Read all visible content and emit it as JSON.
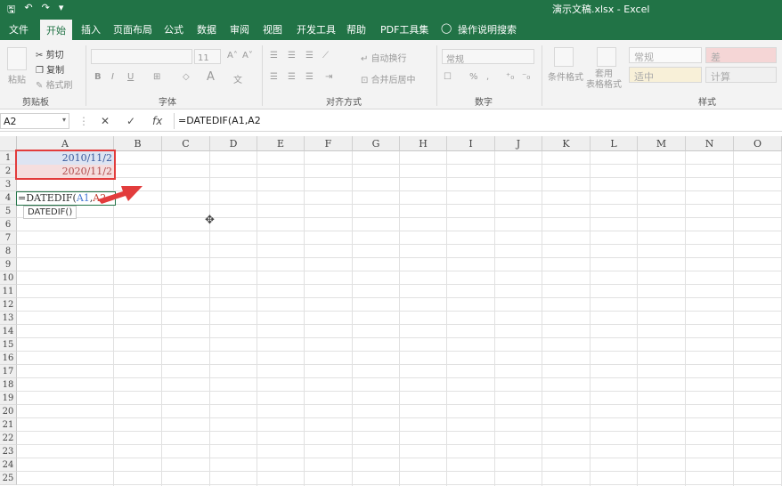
{
  "titlebar": {
    "save": "🖫",
    "undo": "↶",
    "redo": "↷",
    "more": "▾",
    "title": "演示文稿.xlsx  -  Excel"
  },
  "menu": [
    "文件",
    "开始",
    "插入",
    "页面布局",
    "公式",
    "数据",
    "审阅",
    "视图",
    "开发工具",
    "帮助",
    "PDF工具集",
    "操作说明搜索"
  ],
  "ribbon": {
    "clipboard": {
      "paste": "粘贴",
      "cut": "剪切",
      "copy": "复制",
      "format_painter": "格式刷",
      "label": "剪贴板"
    },
    "font": {
      "size": "11",
      "label": "字体"
    },
    "alignment": {
      "wrap": "自动换行",
      "merge": "合并后居中",
      "label": "对齐方式"
    },
    "number": {
      "format": "常规",
      "label": "数字"
    },
    "styles": {
      "cond": "条件格式",
      "table": "套用\n表格格式",
      "normal": "常规",
      "bad": "差",
      "neutral": "适中",
      "calc": "计算",
      "label": "样式"
    }
  },
  "formula_bar": {
    "name_box": "A2",
    "cancel": "✕",
    "enter": "✓",
    "fx": "fx",
    "formula": "=DATEDIF(A1,A2"
  },
  "columns": [
    "A",
    "B",
    "C",
    "D",
    "E",
    "F",
    "G",
    "H",
    "I",
    "J",
    "K",
    "L",
    "M",
    "N",
    "O"
  ],
  "rows": [
    "1",
    "2",
    "3",
    "4",
    "5",
    "6",
    "7",
    "8",
    "9",
    "10",
    "11",
    "12",
    "13",
    "14",
    "15",
    "16",
    "17",
    "18",
    "19",
    "20",
    "21",
    "22",
    "23",
    "24",
    "25"
  ],
  "cells": {
    "A1": "2010/11/2",
    "A2": "2020/11/2",
    "A4_prefix": "=DATEDIF(",
    "A4_ref1": "A1",
    "A4_comma": ",",
    "A4_ref2": "A2"
  },
  "autocomplete_tip": "DATEDIF()",
  "colors": {
    "excel_green": "#217346",
    "highlight_red": "#e23c3c",
    "ref_blue": "#4a7bd4",
    "ref_red": "#c0392b"
  }
}
